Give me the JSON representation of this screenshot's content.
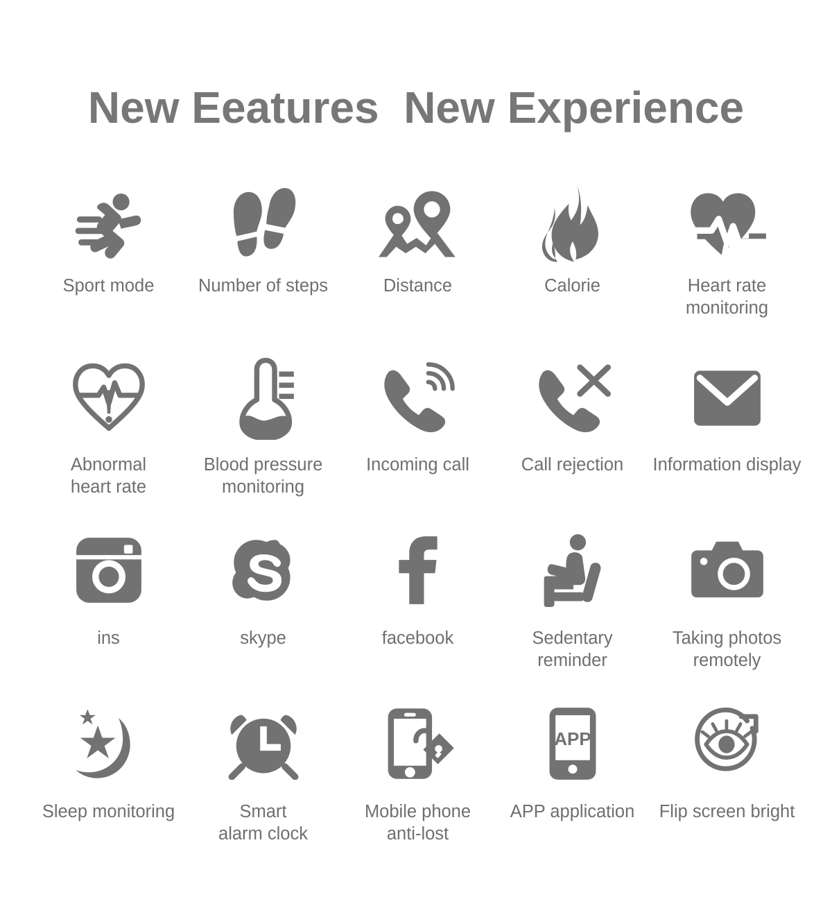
{
  "page": {
    "title": "New Eeatures  New Experience",
    "background_color": "#ffffff",
    "icon_color": "#727272",
    "title_color": "#777777",
    "label_color": "#6f6f6f"
  },
  "features": [
    {
      "label": "Sport mode",
      "icon": "running-person-icon"
    },
    {
      "label": "Number of steps",
      "icon": "footprints-icon"
    },
    {
      "label": "Distance",
      "icon": "map-pins-icon"
    },
    {
      "label": "Calorie",
      "icon": "flame-icon"
    },
    {
      "label": "Heart rate\nmonitoring",
      "icon": "heart-pulse-filled-icon"
    },
    {
      "label": "Abnormal\nheart rate",
      "icon": "heart-pulse-alert-outline-icon"
    },
    {
      "label": "Blood pressure\nmonitoring",
      "icon": "thermometer-icon"
    },
    {
      "label": "Incoming call",
      "icon": "phone-ring-icon"
    },
    {
      "label": "Call rejection",
      "icon": "phone-reject-icon"
    },
    {
      "label": "Information display",
      "icon": "envelope-icon"
    },
    {
      "label": "ins",
      "icon": "instagram-icon"
    },
    {
      "label": "skype",
      "icon": "skype-icon"
    },
    {
      "label": "facebook",
      "icon": "facebook-icon"
    },
    {
      "label": "Sedentary\nreminder",
      "icon": "sitting-person-icon"
    },
    {
      "label": "Taking photos\nremotely",
      "icon": "camera-icon"
    },
    {
      "label": "Sleep monitoring",
      "icon": "moon-stars-icon"
    },
    {
      "label": "Smart\nalarm clock",
      "icon": "alarm-clock-icon"
    },
    {
      "label": "Mobile phone\nanti-lost",
      "icon": "phone-lock-icon"
    },
    {
      "label": "APP application",
      "icon": "phone-app-icon"
    },
    {
      "label": "Flip screen bright",
      "icon": "eye-rotate-icon"
    }
  ],
  "icon_text": {
    "app_screen_label": "APP"
  }
}
